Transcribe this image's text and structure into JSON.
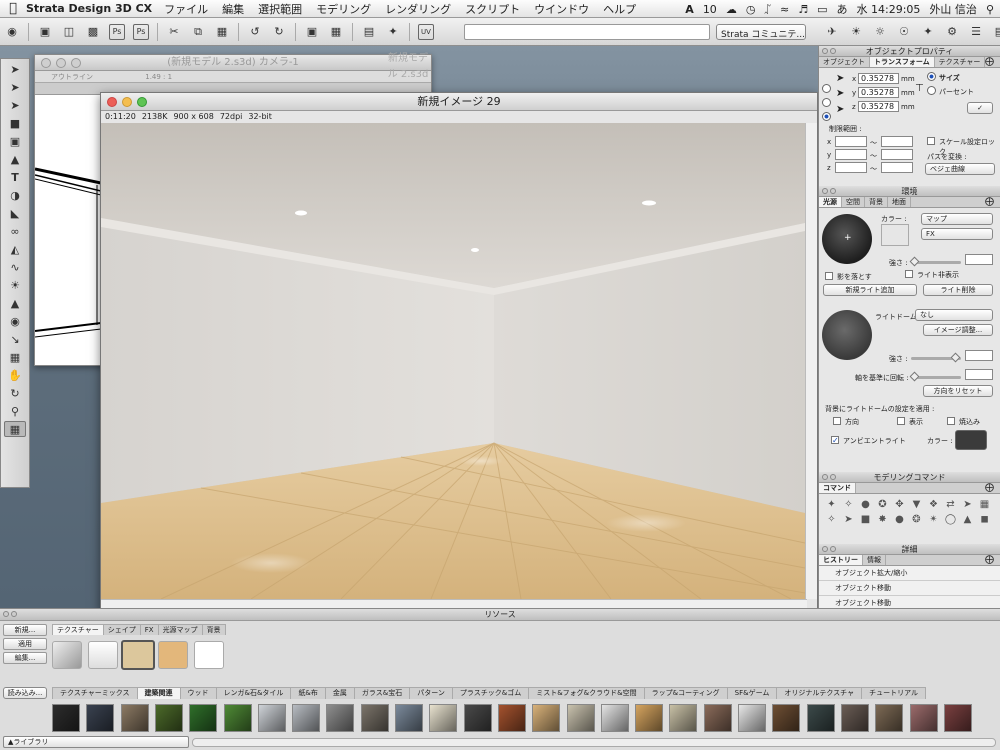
{
  "menubar": {
    "app_name": "Strata Design 3D CX",
    "items": [
      "ファイル",
      "編集",
      "選択範囲",
      "モデリング",
      "レンダリング",
      "スクリプト",
      "ウインドウ",
      "ヘルプ"
    ],
    "adobe_badge": "10",
    "clock": "水 14:29:05",
    "user": "外山 信治"
  },
  "toolbar": {
    "community_select": "Strata コミュニテ..."
  },
  "model_window": {
    "title": "(新規モデル 2.s3d) カメラ-1",
    "ghost_title": "新規モデル 2.s3d",
    "sub_left": "アウトライン",
    "sub_zoom": "1.49 : 1"
  },
  "image_window": {
    "title": "新規イメージ 29",
    "time": "0:11:20",
    "size": "2138K",
    "dims": "900 x 608",
    "dpi": "72dpi",
    "depth": "32-bit"
  },
  "object_props": {
    "title": "オブジェクトプロパティ",
    "tabs": [
      "オブジェクト",
      "トランスフォーム",
      "テクスチャー"
    ],
    "active_tab": 1,
    "x_value": "0.35278",
    "y_value": "0.35278",
    "z_value": "0.35278",
    "unit": "mm",
    "size_label": "サイズ",
    "percent_label": "パーセント",
    "limit_label": "制限範囲 :",
    "axis_x": "x",
    "axis_y": "y",
    "axis_z": "z",
    "tilde": "〜",
    "scale_lock": "スケール設定ロック",
    "path_label": "パスを変換 :",
    "path_select": "ベジェ曲線"
  },
  "environment": {
    "title": "環境",
    "tabs": [
      "光源",
      "空間",
      "背景",
      "地面"
    ],
    "color_label": "カラー :",
    "map_select": "マップ",
    "fx_select": "FX",
    "strength_label": "強さ :",
    "cast_shadow": "影を落とす",
    "light_hidden": "ライト非表示",
    "new_light": "新規ライト追加",
    "delete_light": "ライト削除",
    "lightdome_label": "ライトドーム :",
    "lightdome_select": "なし",
    "image_adjust": "イメージ調整...",
    "strength2_label": "強さ :",
    "rotate_label": "軸を基準に回転 :",
    "reset_dir": "方向をリセット",
    "apply_bg_label": "背景にライトドームの設定を適用 :",
    "opt_dir": "方向",
    "opt_show": "表示",
    "opt_crop": "焼込み",
    "ambient": "アンビエントライト",
    "ambient_color_label": "カラー :"
  },
  "modeling_cmd": {
    "title": "モデリングコマンド",
    "tab": "コマンド"
  },
  "details": {
    "title": "詳細",
    "tabs": [
      "ヒストリー",
      "情報"
    ],
    "history": [
      "オブジェクト拡大/縮小",
      "オブジェクト移動",
      "オブジェクト移動"
    ]
  },
  "resources": {
    "title": "リソース",
    "left_buttons": [
      "新規...",
      "適用",
      "編集..."
    ],
    "load_button": "読み込み...",
    "library": "ライブラリ",
    "type_tabs": [
      "テクスチャー",
      "シェイプ",
      "FX",
      "光源マップ",
      "背景"
    ],
    "category_tabs": [
      "テクスチャーミックス",
      "建築関連",
      "ウッド",
      "レンガ&石&タイル",
      "紙&布",
      "金属",
      "ガラス&宝石",
      "パターン",
      "プラスチック&ゴム",
      "ミスト&フォグ&クラウド&空間",
      "ラップ&コーティング",
      "SF&ゲーム",
      "オリジナルテクスチャ",
      "チュートリアル"
    ],
    "active_category": 1
  },
  "colors": {
    "accent": "#1c4fb7",
    "ambient_swatch": "#3b3b3b",
    "floor": "#d9b986",
    "wall": "#d6d3cf"
  }
}
